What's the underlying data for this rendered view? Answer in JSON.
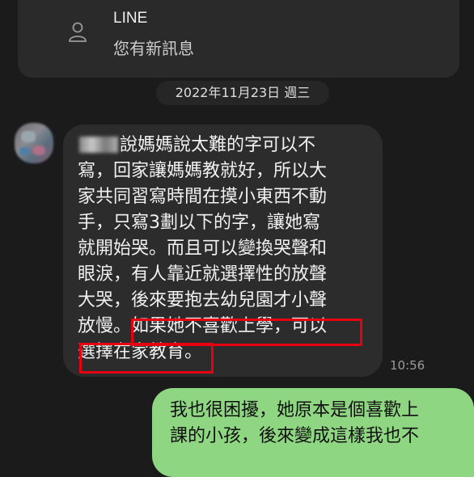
{
  "notification": {
    "app_name": "LINE",
    "message": "您有新訊息",
    "icon": "person-icon"
  },
  "chat": {
    "date_label": "2022年11月23日 週三",
    "incoming": {
      "sender_name_blurred": true,
      "line1_rest": "說媽媽說太難的字可以不",
      "lines_rest": "寫，回家讓媽媽教就好，所以大\n家共同習寫時間在摸小東西不動\n手，只寫3劃以下的字，讓她寫\n就開始哭。而且可以變換哭聲和\n眼淚，有人靠近就選擇性的放聲\n大哭，後來要抱去幼兒園才小聲\n放慢。如果她不喜歡上學，可以\n選擇在家教育。",
      "time": "10:56"
    },
    "outgoing": {
      "text": "我也很困擾，她原本是個喜歡上\n課的小孩，後來變成這樣我也不"
    }
  },
  "colors": {
    "background": "#1b1b1b",
    "incoming_bubble": "#2c2c2c",
    "outgoing_bubble": "#8fd682",
    "highlight": "#e60012"
  }
}
